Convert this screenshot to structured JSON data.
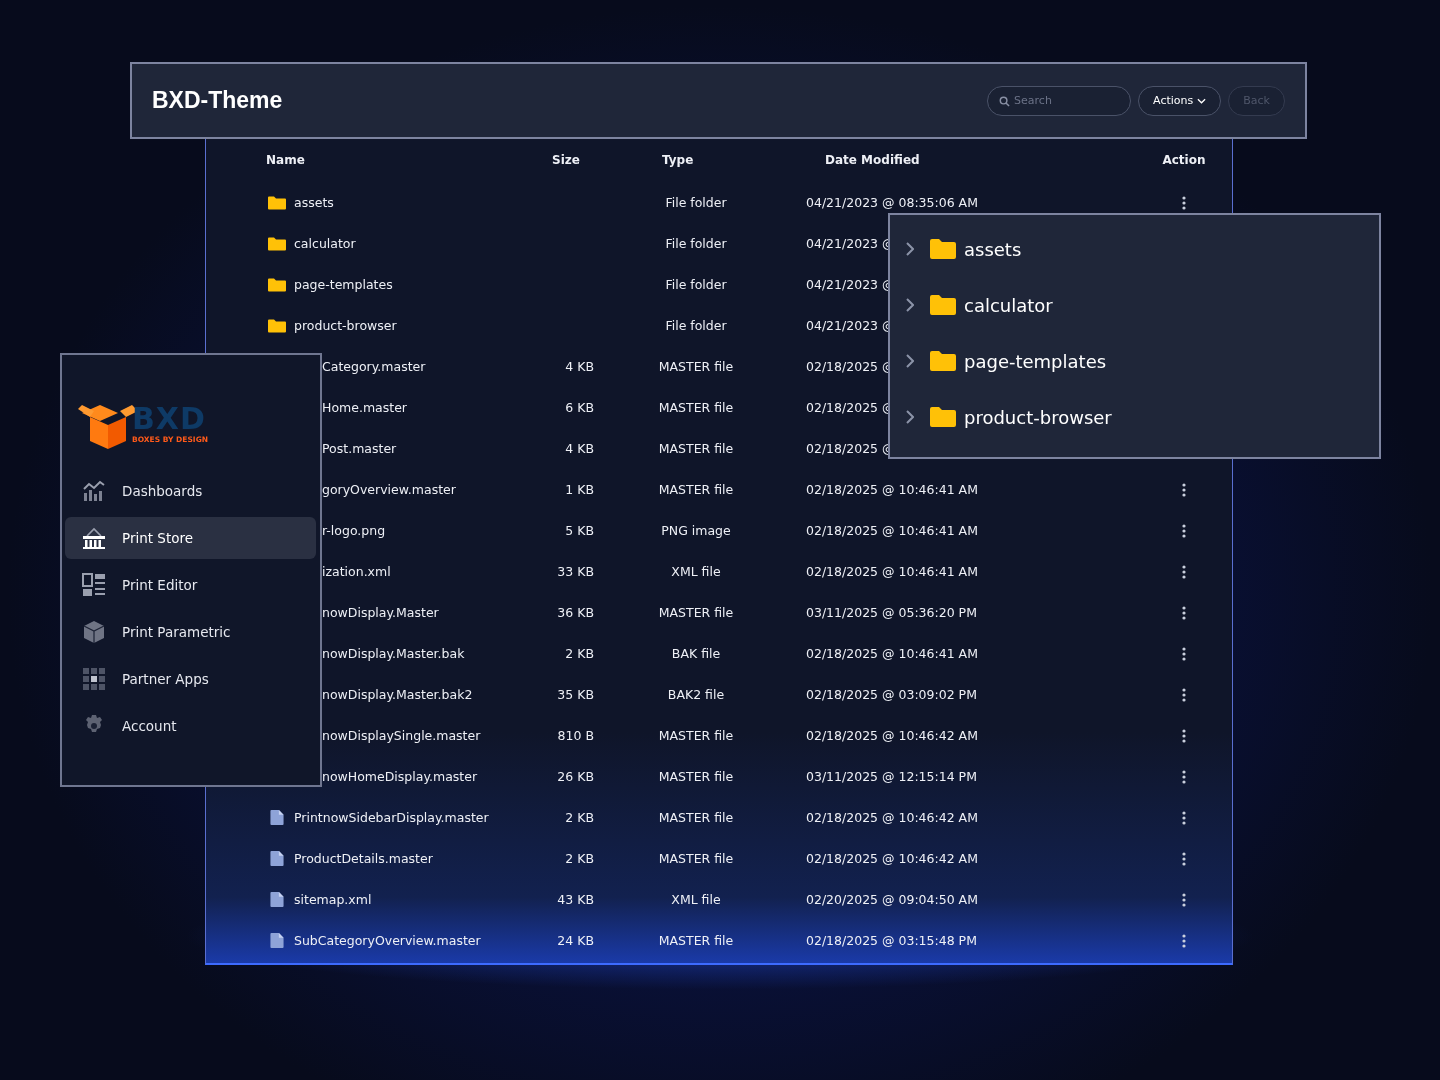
{
  "header": {
    "title": "BXD-Theme",
    "search": {
      "placeholder": "Search"
    },
    "actions_button": "Actions",
    "back_button": {
      "label": "Back",
      "disabled": true
    }
  },
  "table": {
    "columns": [
      "Name",
      "Size",
      "Type",
      "Date Modified",
      "Action"
    ],
    "rows": [
      {
        "kind": "folder",
        "name": "assets",
        "size": "",
        "type": "File folder",
        "date": "04/21/2023 @ 08:35:06 AM",
        "menu": true
      },
      {
        "kind": "folder",
        "name": "calculator",
        "size": "",
        "type": "File folder",
        "date": "04/21/2023 @",
        "menu": false
      },
      {
        "kind": "folder",
        "name": "page-templates",
        "size": "",
        "type": "File folder",
        "date": "04/21/2023 @",
        "menu": false
      },
      {
        "kind": "folder",
        "name": "product-browser",
        "size": "",
        "type": "File folder",
        "date": "04/21/2023 @",
        "menu": false
      },
      {
        "kind": "hidden",
        "name": "Category.master",
        "size": "4 KB",
        "type": "MASTER file",
        "date": "02/18/2025 @",
        "menu": false
      },
      {
        "kind": "hidden",
        "name": "Home.master",
        "size": "6 KB",
        "type": "MASTER file",
        "date": "02/18/2025 @",
        "menu": false
      },
      {
        "kind": "hidden",
        "name": "Post.master",
        "size": "4 KB",
        "type": "MASTER file",
        "date": "02/18/2025 @",
        "menu": false
      },
      {
        "kind": "hidden",
        "name": "goryOverview.master",
        "size": "1 KB",
        "type": "MASTER file",
        "date": "02/18/2025 @ 10:46:41 AM",
        "menu": true
      },
      {
        "kind": "hidden",
        "name": "r-logo.png",
        "size": "5 KB",
        "type": "PNG image",
        "date": "02/18/2025 @ 10:46:41 AM",
        "menu": true
      },
      {
        "kind": "hidden",
        "name": "ization.xml",
        "size": "33 KB",
        "type": "XML file",
        "date": "02/18/2025 @ 10:46:41 AM",
        "menu": true
      },
      {
        "kind": "hidden",
        "name": "nowDisplay.Master",
        "size": "36 KB",
        "type": "MASTER file",
        "date": "03/11/2025 @ 05:36:20 PM",
        "menu": true
      },
      {
        "kind": "hidden",
        "name": "nowDisplay.Master.bak",
        "size": "2 KB",
        "type": "BAK file",
        "date": "02/18/2025 @ 10:46:41 AM",
        "menu": true
      },
      {
        "kind": "hidden",
        "name": "nowDisplay.Master.bak2",
        "size": "35 KB",
        "type": "BAK2 file",
        "date": "02/18/2025 @ 03:09:02 PM",
        "menu": true
      },
      {
        "kind": "hidden",
        "name": "nowDisplaySingle.master",
        "size": "810 B",
        "type": "MASTER file",
        "date": "02/18/2025 @ 10:46:42 AM",
        "menu": true
      },
      {
        "kind": "hidden",
        "name": "nowHomeDisplay.master",
        "size": "26 KB",
        "type": "MASTER file",
        "date": "03/11/2025 @ 12:15:14 PM",
        "menu": true
      },
      {
        "kind": "file",
        "name": "PrintnowSidebarDisplay.master",
        "size": "2 KB",
        "type": "MASTER file",
        "date": "02/18/2025 @ 10:46:42 AM",
        "menu": true
      },
      {
        "kind": "file",
        "name": "ProductDetails.master",
        "size": "2 KB",
        "type": "MASTER file",
        "date": "02/18/2025 @ 10:46:42 AM",
        "menu": true
      },
      {
        "kind": "file",
        "name": "sitemap.xml",
        "size": "43 KB",
        "type": "XML file",
        "date": "02/20/2025 @ 09:04:50 AM",
        "menu": true
      },
      {
        "kind": "file",
        "name": "SubCategoryOverview.master",
        "size": "24 KB",
        "type": "MASTER file",
        "date": "02/18/2025 @ 03:15:48 PM",
        "menu": true
      }
    ]
  },
  "sidebar": {
    "logo": {
      "wordmark": "BXD",
      "tagline": "BOXES BY DESIGN"
    },
    "items": [
      {
        "label": "Dashboards",
        "selected": false
      },
      {
        "label": "Print Store",
        "selected": true
      },
      {
        "label": "Print Editor",
        "selected": false
      },
      {
        "label": "Print Parametric",
        "selected": false
      },
      {
        "label": "Partner Apps",
        "selected": false
      },
      {
        "label": "Account",
        "selected": false
      }
    ]
  },
  "folder_tree": {
    "items": [
      {
        "name": "assets",
        "expanded": false
      },
      {
        "name": "calculator",
        "expanded": false
      },
      {
        "name": "page-templates",
        "expanded": false
      },
      {
        "name": "product-browser",
        "expanded": false
      }
    ]
  }
}
